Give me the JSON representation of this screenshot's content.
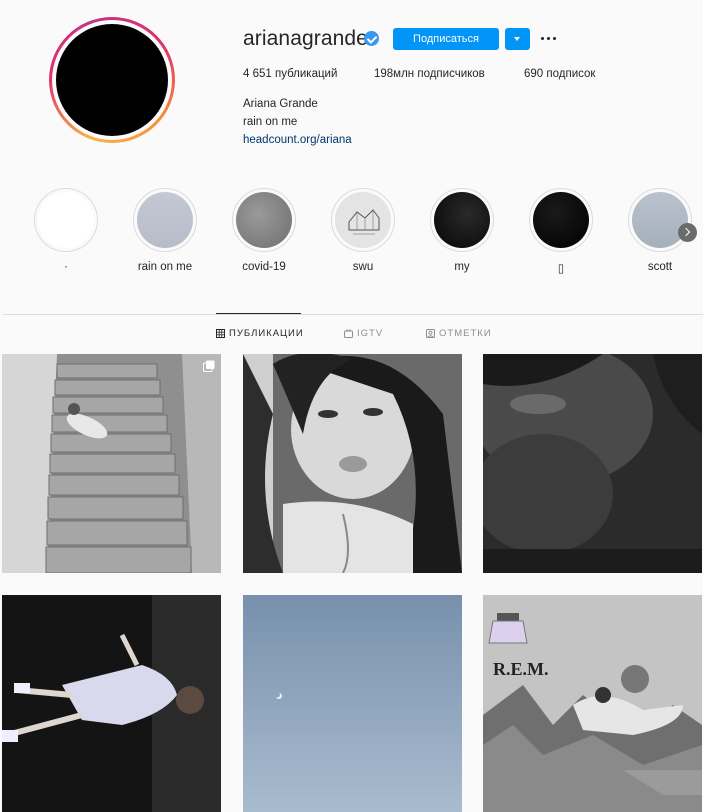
{
  "profile": {
    "username": "arianagrande",
    "follow_label": "Подписаться",
    "stats": {
      "posts": "4 651 публикаций",
      "followers": "198млн подписчиков",
      "following": "690 подписок"
    },
    "full_name": "Ariana Grande",
    "bio": "rain on me",
    "link": "headcount.org/ariana"
  },
  "highlights": [
    {
      "label": "·"
    },
    {
      "label": "rain on me"
    },
    {
      "label": "covid-19"
    },
    {
      "label": "swu"
    },
    {
      "label": "my"
    },
    {
      "label": "▯"
    },
    {
      "label": "scott"
    }
  ],
  "tabs": [
    {
      "label": "ПУБЛИКАЦИИ",
      "icon": "grid-icon",
      "active": true
    },
    {
      "label": "IGTV",
      "icon": "igtv-icon",
      "active": false
    },
    {
      "label": "ОТМЕТКИ",
      "icon": "tagged-icon",
      "active": false
    }
  ],
  "colors": {
    "accent": "#0095f6",
    "verified": "#3897f0",
    "link": "#00376b",
    "text": "#262626",
    "muted": "#8e8e8e",
    "background": "#fafafa"
  }
}
